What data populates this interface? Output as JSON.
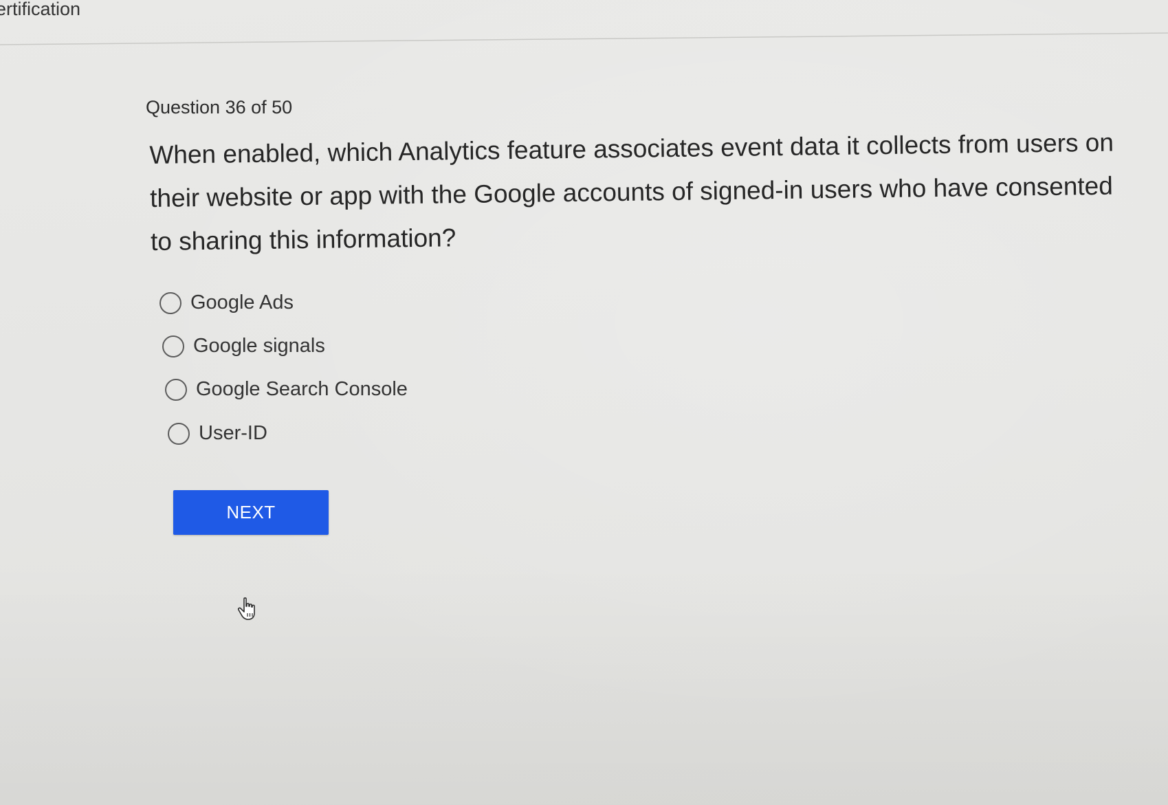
{
  "header": {
    "title": "ertification"
  },
  "quiz": {
    "progress_label": "Question 36 of 50",
    "question": "When enabled, which Analytics feature associates event data it collects from users on their website or app with the Google accounts of signed-in users who have consented to sharing this information?",
    "options": [
      {
        "label": "Google Ads",
        "selected": false
      },
      {
        "label": "Google signals",
        "selected": false
      },
      {
        "label": "Google Search Console",
        "selected": false
      },
      {
        "label": "User-ID",
        "selected": false
      }
    ],
    "next_label": "NEXT"
  },
  "colors": {
    "background": "#e6e6e4",
    "button": "#1f5ae6",
    "button_text": "#ffffff",
    "text": "#2e2e2e"
  },
  "icons": {
    "radio": "radio-unchecked-icon",
    "pointer": "hand-pointer-icon"
  }
}
